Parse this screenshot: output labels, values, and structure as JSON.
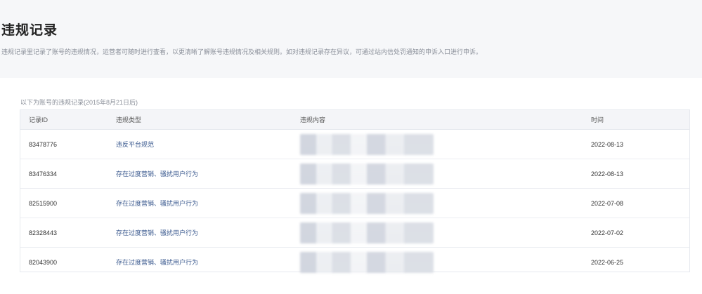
{
  "header": {
    "title": "违规记录",
    "description": "违规记录里记录了账号的违规情况，运营者可随时进行查看，以更清晰了解账号违规情况及相关规则。如对违规记录存在异议，可通过站内信处罚通知的申诉入口进行申诉。"
  },
  "table": {
    "caption": "以下为账号的违规记录(2015年8月21日后)",
    "columns": [
      "记录ID",
      "违规类型",
      "违规内容",
      "时间"
    ],
    "rows": [
      {
        "id": "83478776",
        "type": "违反平台规范",
        "time": "2022-08-13"
      },
      {
        "id": "83476334",
        "type": "存在过度营销、骚扰用户行为",
        "time": "2022-08-13"
      },
      {
        "id": "82515900",
        "type": "存在过度营销、骚扰用户行为",
        "time": "2022-07-08"
      },
      {
        "id": "82328443",
        "type": "存在过度营销、骚扰用户行为",
        "time": "2022-07-02"
      },
      {
        "id": "82043900",
        "type": "存在过度营销、骚扰用户行为",
        "time": "2022-06-25"
      }
    ]
  }
}
